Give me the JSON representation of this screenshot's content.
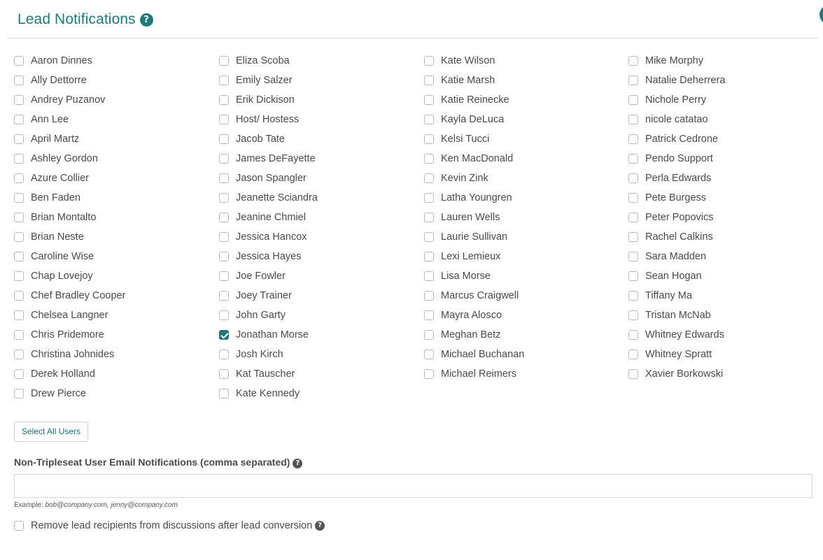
{
  "header": {
    "title": "Lead Notifications",
    "help_icon": "question-circle-icon"
  },
  "users": {
    "columns": [
      [
        {
          "name": "Aaron Dinnes",
          "checked": false
        },
        {
          "name": "Ally Dettorre",
          "checked": false
        },
        {
          "name": "Andrey Puzanov",
          "checked": false
        },
        {
          "name": "Ann Lee",
          "checked": false
        },
        {
          "name": "April Martz",
          "checked": false
        },
        {
          "name": "Ashley Gordon",
          "checked": false
        },
        {
          "name": "Azure Collier",
          "checked": false
        },
        {
          "name": "Ben Faden",
          "checked": false
        },
        {
          "name": "Brian Montalto",
          "checked": false
        },
        {
          "name": "Brian Neste",
          "checked": false
        },
        {
          "name": "Caroline Wise",
          "checked": false
        },
        {
          "name": "Chap Lovejoy",
          "checked": false
        },
        {
          "name": "Chef Bradley Cooper",
          "checked": false
        },
        {
          "name": "Chelsea Langner",
          "checked": false
        },
        {
          "name": "Chris Pridemore",
          "checked": false
        },
        {
          "name": "Christina Johnides",
          "checked": false
        },
        {
          "name": "Derek Holland",
          "checked": false
        },
        {
          "name": "Drew Pierce",
          "checked": false
        }
      ],
      [
        {
          "name": "Eliza Scoba",
          "checked": false
        },
        {
          "name": "Emily Salzer",
          "checked": false
        },
        {
          "name": "Erik Dickison",
          "checked": false
        },
        {
          "name": "Host/ Hostess",
          "checked": false
        },
        {
          "name": "Jacob Tate",
          "checked": false
        },
        {
          "name": "James DeFayette",
          "checked": false
        },
        {
          "name": "Jason Spangler",
          "checked": false
        },
        {
          "name": "Jeanette Sciandra",
          "checked": false
        },
        {
          "name": "Jeanine Chmiel",
          "checked": false
        },
        {
          "name": "Jessica Hancox",
          "checked": false
        },
        {
          "name": "Jessica Hayes",
          "checked": false
        },
        {
          "name": "Joe Fowler",
          "checked": false
        },
        {
          "name": "Joey Trainer",
          "checked": false
        },
        {
          "name": "John Garty",
          "checked": false
        },
        {
          "name": "Jonathan Morse",
          "checked": true
        },
        {
          "name": "Josh Kirch",
          "checked": false
        },
        {
          "name": "Kat Tauscher",
          "checked": false
        },
        {
          "name": "Kate Kennedy",
          "checked": false
        }
      ],
      [
        {
          "name": "Kate Wilson",
          "checked": false
        },
        {
          "name": "Katie Marsh",
          "checked": false
        },
        {
          "name": "Katie Reinecke",
          "checked": false
        },
        {
          "name": "Kayla DeLuca",
          "checked": false
        },
        {
          "name": "Kelsi Tucci",
          "checked": false
        },
        {
          "name": "Ken MacDonald",
          "checked": false
        },
        {
          "name": "Kevin Zink",
          "checked": false
        },
        {
          "name": "Latha Youngren",
          "checked": false
        },
        {
          "name": "Lauren Wells",
          "checked": false
        },
        {
          "name": "Laurie Sullivan",
          "checked": false
        },
        {
          "name": "Lexi Lemieux",
          "checked": false
        },
        {
          "name": "Lisa Morse",
          "checked": false
        },
        {
          "name": "Marcus Craigwell",
          "checked": false
        },
        {
          "name": "Mayra Alosco",
          "checked": false
        },
        {
          "name": "Meghan Betz",
          "checked": false
        },
        {
          "name": "Michael Buchanan",
          "checked": false
        },
        {
          "name": "Michael Reimers",
          "checked": false
        }
      ],
      [
        {
          "name": "Mike Morphy",
          "checked": false
        },
        {
          "name": "Natalie Deherrera",
          "checked": false
        },
        {
          "name": "Nichole Perry",
          "checked": false
        },
        {
          "name": "nicole catatao",
          "checked": false
        },
        {
          "name": "Patrick Cedrone",
          "checked": false
        },
        {
          "name": "Pendo Support",
          "checked": false
        },
        {
          "name": "Perla Edwards",
          "checked": false
        },
        {
          "name": "Pete Burgess",
          "checked": false
        },
        {
          "name": "Peter Popovics",
          "checked": false
        },
        {
          "name": "Rachel Calkins",
          "checked": false
        },
        {
          "name": "Sara Madden",
          "checked": false
        },
        {
          "name": "Sean Hogan",
          "checked": false
        },
        {
          "name": "Tiffany Ma",
          "checked": false
        },
        {
          "name": "Tristan McNab",
          "checked": false
        },
        {
          "name": "Whitney Edwards",
          "checked": false
        },
        {
          "name": "Whitney Spratt",
          "checked": false
        },
        {
          "name": "Xavier Borkowski",
          "checked": false
        }
      ]
    ]
  },
  "select_all_label": "Select All Users",
  "email": {
    "label": "Non-Tripleseat User Email Notifications (comma separated)",
    "value": "",
    "example_prefix": "Example: ",
    "example_value": "bob@company.com, jenny@company.com"
  },
  "remove_recipients": {
    "label": "Remove lead recipients from discussions after lead conversion",
    "checked": false
  },
  "colors": {
    "accent": "#1f7a7a",
    "text": "#4a4a4a",
    "border": "#dcdcdc"
  }
}
